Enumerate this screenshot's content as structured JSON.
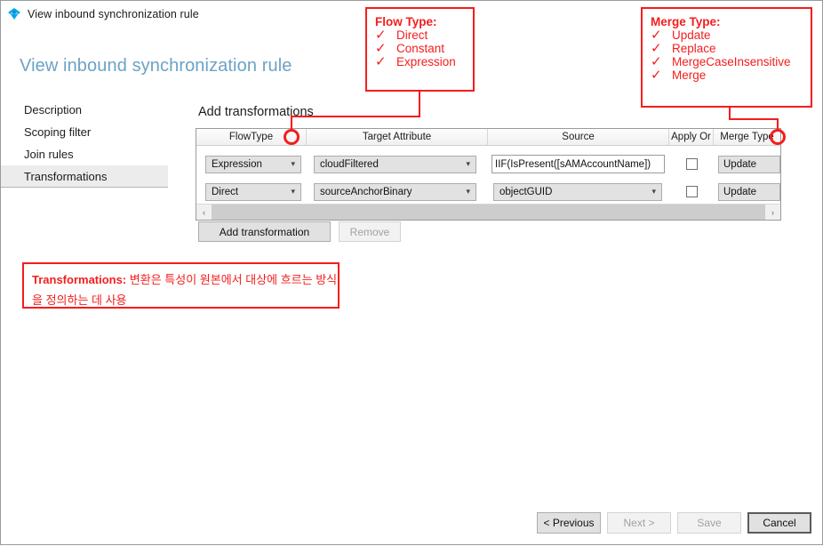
{
  "window": {
    "title": "View inbound synchronization rule",
    "icon": "azure-ad-connect-diamond-icon"
  },
  "page": {
    "heading": "View inbound synchronization rule"
  },
  "sidebar": {
    "items": [
      {
        "label": "Description",
        "selected": false
      },
      {
        "label": "Scoping filter",
        "selected": false
      },
      {
        "label": "Join rules",
        "selected": false
      },
      {
        "label": "Transformations",
        "selected": true
      }
    ]
  },
  "main": {
    "section_title": "Add transformations",
    "grid": {
      "columns": [
        "FlowType",
        "Target Attribute",
        "Source",
        "Apply Or",
        "Merge Type"
      ],
      "rows": [
        {
          "flowtype": "Expression",
          "target_attribute": "cloudFiltered",
          "source": "IIF(IsPresent([sAMAccountName])",
          "source_kind": "text",
          "apply_or": false,
          "merge_type": "Update"
        },
        {
          "flowtype": "Direct",
          "target_attribute": "sourceAnchorBinary",
          "source": "objectGUID",
          "source_kind": "combo",
          "apply_or": false,
          "merge_type": "Update"
        }
      ],
      "scrollbar": {
        "left_arrow": "‹",
        "right_arrow": "›"
      }
    },
    "actions": [
      {
        "label": "Add transformation",
        "disabled": false
      },
      {
        "label": "Remove",
        "disabled": true
      }
    ]
  },
  "footer": {
    "buttons": [
      {
        "label": "< Previous",
        "disabled": false,
        "focused": false
      },
      {
        "label": "Next >",
        "disabled": true,
        "focused": false
      },
      {
        "label": "Save",
        "disabled": true,
        "focused": false
      },
      {
        "label": "Cancel",
        "disabled": false,
        "focused": true
      }
    ]
  },
  "annotations": {
    "accent_color": "#f41d1d",
    "flow_type": {
      "title": "Flow Type:",
      "items": [
        "Direct",
        "Constant",
        "Expression"
      ],
      "tick": "✓"
    },
    "merge_type": {
      "title": "Merge Type:",
      "items": [
        "Update",
        "Replace",
        "MergeCaseInsensitive",
        "Merge"
      ],
      "tick": "✓"
    },
    "korean_note": {
      "label": "Transformations:",
      "text": " 변환은 특성이 원본에서 대상에 흐르는 방식을 정의하는 데 사용"
    }
  },
  "theme": {
    "heading_color": "#6da2c6",
    "title_icon_color": "#00a6e8",
    "selected_nav_bg": "#ececec"
  }
}
